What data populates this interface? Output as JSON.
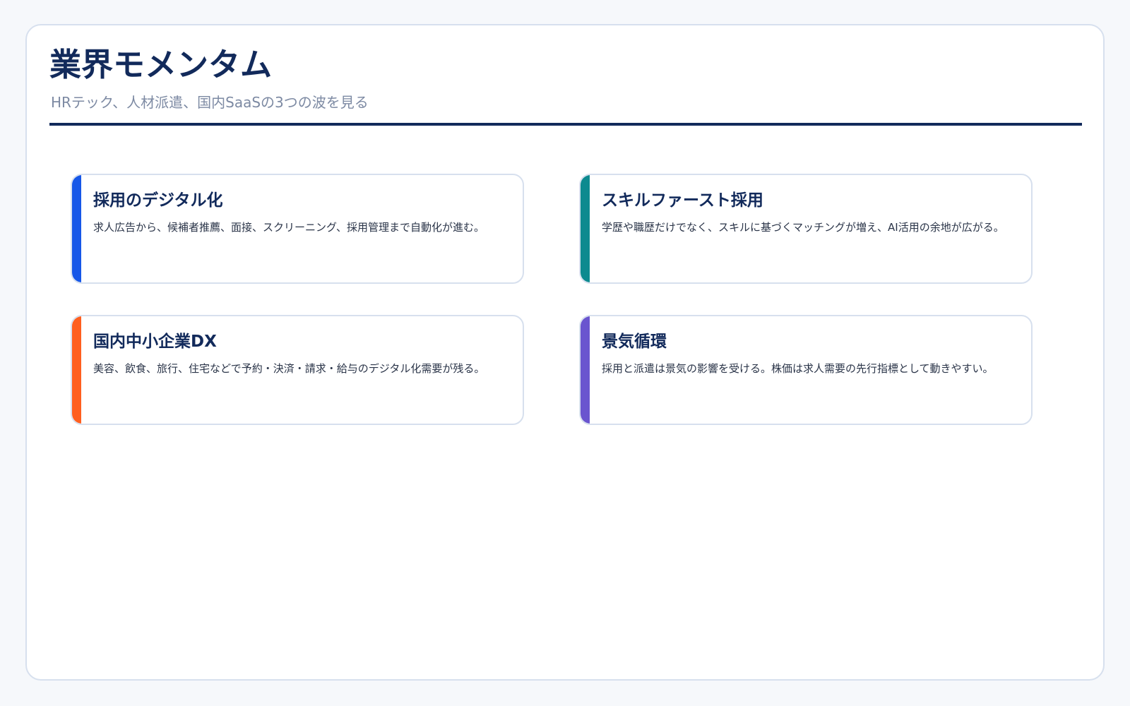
{
  "header": {
    "title": "業界モメンタム",
    "subtitle": "HRテック、人材派遣、国内SaaSの3つの波を見る"
  },
  "cards": [
    {
      "title": "採用のデジタル化",
      "description": "求人広告から、候補者推薦、面接、スクリーニング、採用管理まで自動化が進む。",
      "accent_color": "#1657e8"
    },
    {
      "title": "スキルファースト採用",
      "description": "学歴や職歴だけでなく、スキルに基づくマッチングが増え、AI活用の余地が広がる。",
      "accent_color": "#0d8a8f"
    },
    {
      "title": "国内中小企業DX",
      "description": "美容、飲食、旅行、住宅などで予約・決済・請求・給与のデジタル化需要が残る。",
      "accent_color": "#ff5f1f"
    },
    {
      "title": "景気循環",
      "description": "採用と派遣は景気の影響を受ける。株価は求人需要の先行指標として動きやすい。",
      "accent_color": "#6a55cf"
    }
  ]
}
